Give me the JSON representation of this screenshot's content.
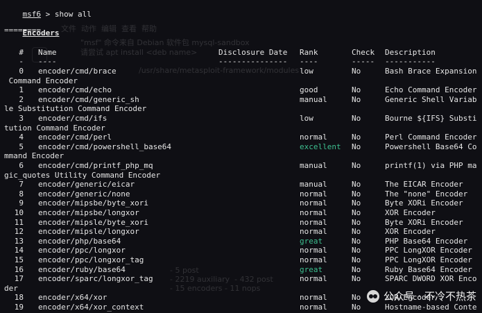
{
  "prompt": {
    "shell": "msf6",
    "symbol": ">",
    "command": "show all"
  },
  "section": {
    "title": "Encoders",
    "underline": "========"
  },
  "columns": {
    "num": "#",
    "name": "Name",
    "date": "Disclosure Date",
    "rank": "Rank",
    "check": "Check",
    "desc": "Description",
    "num_ul": "-",
    "name_ul": "----",
    "date_ul": "---------------",
    "rank_ul": "----",
    "check_ul": "-----",
    "desc_ul": "-----------"
  },
  "rows": [
    {
      "num": "0",
      "name": "encoder/cmd/brace",
      "rank": "low",
      "rank_color": "",
      "check": "No",
      "desc": "Bash Brace Expansion",
      "wrap": " Command Encoder"
    },
    {
      "num": "1",
      "name": "encoder/cmd/echo",
      "rank": "good",
      "rank_color": "",
      "check": "No",
      "desc": "Echo Command Encoder",
      "wrap": ""
    },
    {
      "num": "2",
      "name": "encoder/cmd/generic_sh",
      "rank": "manual",
      "rank_color": "",
      "check": "No",
      "desc": "Generic Shell Variab",
      "wrap": "le Substitution Command Encoder"
    },
    {
      "num": "3",
      "name": "encoder/cmd/ifs",
      "rank": "low",
      "rank_color": "",
      "check": "No",
      "desc": "Bourne ${IFS} Substi",
      "wrap": "tution Command Encoder"
    },
    {
      "num": "4",
      "name": "encoder/cmd/perl",
      "rank": "normal",
      "rank_color": "",
      "check": "No",
      "desc": "Perl Command Encoder",
      "wrap": ""
    },
    {
      "num": "5",
      "name": "encoder/cmd/powershell_base64",
      "rank": "excellent",
      "rank_color": "excellent",
      "check": "No",
      "desc": "Powershell Base64 Co",
      "wrap": "mmand Encoder"
    },
    {
      "num": "6",
      "name": "encoder/cmd/printf_php_mq",
      "rank": "manual",
      "rank_color": "",
      "check": "No",
      "desc": "printf(1) via PHP ma",
      "wrap": "gic_quotes Utility Command Encoder"
    },
    {
      "num": "7",
      "name": "encoder/generic/eicar",
      "rank": "manual",
      "rank_color": "",
      "check": "No",
      "desc": "The EICAR Encoder",
      "wrap": ""
    },
    {
      "num": "8",
      "name": "encoder/generic/none",
      "rank": "normal",
      "rank_color": "",
      "check": "No",
      "desc": "The \"none\" Encoder",
      "wrap": ""
    },
    {
      "num": "9",
      "name": "encoder/mipsbe/byte_xori",
      "rank": "normal",
      "rank_color": "",
      "check": "No",
      "desc": "Byte XORi Encoder",
      "wrap": ""
    },
    {
      "num": "10",
      "name": "encoder/mipsbe/longxor",
      "rank": "normal",
      "rank_color": "",
      "check": "No",
      "desc": "XOR Encoder",
      "wrap": ""
    },
    {
      "num": "11",
      "name": "encoder/mipsle/byte_xori",
      "rank": "normal",
      "rank_color": "",
      "check": "No",
      "desc": "Byte XORi Encoder",
      "wrap": ""
    },
    {
      "num": "12",
      "name": "encoder/mipsle/longxor",
      "rank": "normal",
      "rank_color": "",
      "check": "No",
      "desc": "XOR Encoder",
      "wrap": ""
    },
    {
      "num": "13",
      "name": "encoder/php/base64",
      "rank": "great",
      "rank_color": "great",
      "check": "No",
      "desc": "PHP Base64 Encoder",
      "wrap": ""
    },
    {
      "num": "14",
      "name": "encoder/ppc/longxor",
      "rank": "normal",
      "rank_color": "",
      "check": "No",
      "desc": "PPC LongXOR Encoder",
      "wrap": ""
    },
    {
      "num": "15",
      "name": "encoder/ppc/longxor_tag",
      "rank": "normal",
      "rank_color": "",
      "check": "No",
      "desc": "PPC LongXOR Encoder",
      "wrap": ""
    },
    {
      "num": "16",
      "name": "encoder/ruby/base64",
      "rank": "great",
      "rank_color": "great",
      "check": "No",
      "desc": "Ruby Base64 Encoder",
      "wrap": ""
    },
    {
      "num": "17",
      "name": "encoder/sparc/longxor_tag",
      "rank": "normal",
      "rank_color": "",
      "check": "No",
      "desc": "SPARC DWORD XOR Enco",
      "wrap": "der"
    },
    {
      "num": "18",
      "name": "encoder/x64/xor",
      "rank": "normal",
      "rank_color": "",
      "check": "No",
      "desc": "XOR Encoder",
      "wrap": ""
    },
    {
      "num": "19",
      "name": "encoder/x64/xor_context",
      "rank": "normal",
      "rank_color": "",
      "check": "No",
      "desc": "Hostname-based Conte",
      "wrap": ""
    }
  ],
  "ghost": {
    "menu": "文件  动作  编辑  查看  帮助",
    "line1": "\"msf\" 命令来自 Debian 软件包 mysql-sandbox",
    "line2": "请尝试 apt install <deb name>",
    "line3": "/usr/share/metasploit-framework/modules",
    "line4": "- 5 post",
    "line5": "- 2219 auxiliary  - 432 post",
    "line6": "- 15 encoders - 11 nops"
  },
  "watermark": {
    "text": "公众号 · 不冷不热茶",
    "icon": "wechat-icon"
  }
}
